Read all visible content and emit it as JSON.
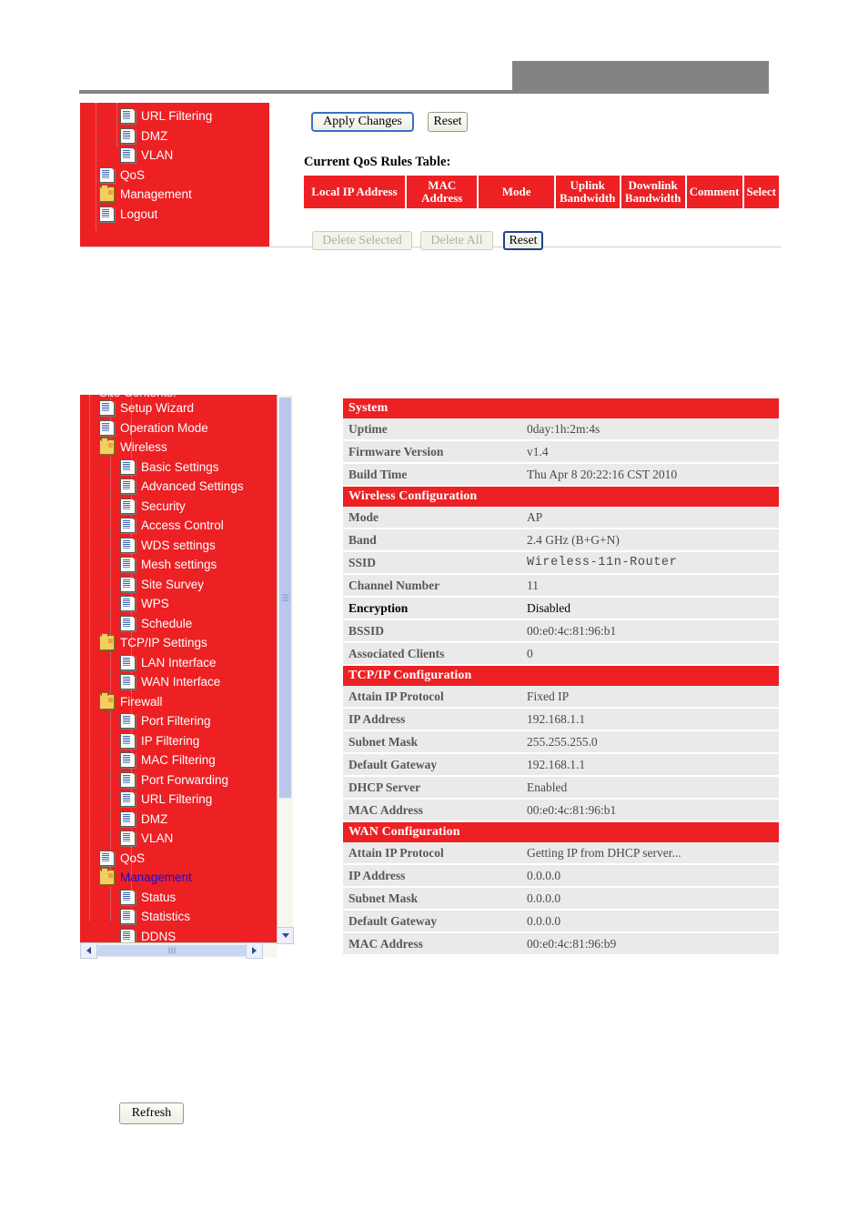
{
  "header": {
    "band_color": "#838383",
    "rule_color": "#838383"
  },
  "colors": {
    "sidebar_red": "#ED2024",
    "table_header_red": "#ED2024",
    "row_gray": "#EAEAEA",
    "selected_link_blue": "#1111DD"
  },
  "qos_panel": {
    "apply_button": "Apply Changes",
    "reset_button_top": "Reset",
    "table_caption": "Current QoS Rules Table:",
    "table_headers": [
      "Local IP Address",
      "MAC Address",
      "Mode",
      "Uplink Bandwidth",
      "Downlink Bandwidth",
      "Comment",
      "Select"
    ],
    "table_rows": [],
    "delete_selected_button": "Delete Selected",
    "delete_all_button": "Delete All",
    "reset_button_bottom": "Reset",
    "sidebar_items": [
      {
        "label": "URL Filtering",
        "icon": "page-icon",
        "level": 2
      },
      {
        "label": "DMZ",
        "icon": "page-icon",
        "level": 2
      },
      {
        "label": "VLAN",
        "icon": "page-icon",
        "level": 2
      },
      {
        "label": "QoS",
        "icon": "page-icon",
        "level": 1
      },
      {
        "label": "Management",
        "icon": "folder-icon",
        "level": 1
      },
      {
        "label": "Logout",
        "icon": "page-icon",
        "level": 1
      }
    ]
  },
  "status_panel": {
    "tree_title": "Site Contents:",
    "sidebar_items": [
      {
        "label": "Setup Wizard",
        "icon": "page-icon",
        "level": 1,
        "selected": false
      },
      {
        "label": "Operation Mode",
        "icon": "page-icon",
        "level": 1,
        "selected": false
      },
      {
        "label": "Wireless",
        "icon": "folder-icon",
        "level": 1,
        "selected": false
      },
      {
        "label": "Basic Settings",
        "icon": "page-icon",
        "level": 2,
        "selected": false
      },
      {
        "label": "Advanced Settings",
        "icon": "page-icon",
        "level": 2,
        "selected": false
      },
      {
        "label": "Security",
        "icon": "page-icon",
        "level": 2,
        "selected": false
      },
      {
        "label": "Access Control",
        "icon": "page-icon",
        "level": 2,
        "selected": false
      },
      {
        "label": "WDS settings",
        "icon": "page-icon",
        "level": 2,
        "selected": false
      },
      {
        "label": "Mesh settings",
        "icon": "page-icon",
        "level": 2,
        "selected": false
      },
      {
        "label": "Site Survey",
        "icon": "page-icon",
        "level": 2,
        "selected": false
      },
      {
        "label": "WPS",
        "icon": "page-icon",
        "level": 2,
        "selected": false
      },
      {
        "label": "Schedule",
        "icon": "page-icon",
        "level": 2,
        "selected": false
      },
      {
        "label": "TCP/IP Settings",
        "icon": "folder-icon",
        "level": 1,
        "selected": false
      },
      {
        "label": "LAN Interface",
        "icon": "page-icon",
        "level": 2,
        "selected": false
      },
      {
        "label": "WAN Interface",
        "icon": "page-icon",
        "level": 2,
        "selected": false
      },
      {
        "label": "Firewall",
        "icon": "folder-icon",
        "level": 1,
        "selected": false
      },
      {
        "label": "Port Filtering",
        "icon": "page-icon",
        "level": 2,
        "selected": false
      },
      {
        "label": "IP Filtering",
        "icon": "page-icon",
        "level": 2,
        "selected": false
      },
      {
        "label": "MAC Filtering",
        "icon": "page-icon",
        "level": 2,
        "selected": false
      },
      {
        "label": "Port Forwarding",
        "icon": "page-icon",
        "level": 2,
        "selected": false
      },
      {
        "label": "URL Filtering",
        "icon": "page-icon",
        "level": 2,
        "selected": false
      },
      {
        "label": "DMZ",
        "icon": "page-icon",
        "level": 2,
        "selected": false
      },
      {
        "label": "VLAN",
        "icon": "page-icon",
        "level": 2,
        "selected": false
      },
      {
        "label": "QoS",
        "icon": "page-icon",
        "level": 1,
        "selected": false
      },
      {
        "label": "Management",
        "icon": "folder-icon",
        "level": 1,
        "selected": true
      },
      {
        "label": "Status",
        "icon": "page-icon",
        "level": 2,
        "selected": false
      },
      {
        "label": "Statistics",
        "icon": "page-icon",
        "level": 2,
        "selected": false
      },
      {
        "label": "DDNS",
        "icon": "page-icon",
        "level": 2,
        "selected": false
      }
    ],
    "sections": [
      {
        "title": "System",
        "rows": [
          {
            "key": "Uptime",
            "value": "0day:1h:2m:4s",
            "emphasis": false,
            "mono": false
          },
          {
            "key": "Firmware Version",
            "value": "v1.4",
            "emphasis": false,
            "mono": false
          },
          {
            "key": "Build Time",
            "value": "Thu Apr 8 20:22:16 CST 2010",
            "emphasis": false,
            "mono": false
          }
        ]
      },
      {
        "title": "Wireless Configuration",
        "rows": [
          {
            "key": "Mode",
            "value": "AP",
            "emphasis": false,
            "mono": false
          },
          {
            "key": "Band",
            "value": "2.4 GHz (B+G+N)",
            "emphasis": false,
            "mono": false
          },
          {
            "key": "SSID",
            "value": "Wireless-11n-Router",
            "emphasis": false,
            "mono": true
          },
          {
            "key": "Channel Number",
            "value": "11",
            "emphasis": false,
            "mono": false
          },
          {
            "key": "Encryption",
            "value": "Disabled",
            "emphasis": true,
            "mono": false
          },
          {
            "key": "BSSID",
            "value": "00:e0:4c:81:96:b1",
            "emphasis": false,
            "mono": false
          },
          {
            "key": "Associated Clients",
            "value": "0",
            "emphasis": false,
            "mono": false
          }
        ]
      },
      {
        "title": "TCP/IP Configuration",
        "rows": [
          {
            "key": "Attain IP Protocol",
            "value": "Fixed IP",
            "emphasis": false,
            "mono": false
          },
          {
            "key": "IP Address",
            "value": "192.168.1.1",
            "emphasis": false,
            "mono": false
          },
          {
            "key": "Subnet Mask",
            "value": "255.255.255.0",
            "emphasis": false,
            "mono": false
          },
          {
            "key": "Default Gateway",
            "value": "192.168.1.1",
            "emphasis": false,
            "mono": false
          },
          {
            "key": "DHCP Server",
            "value": "Enabled",
            "emphasis": false,
            "mono": false
          },
          {
            "key": "MAC Address",
            "value": "00:e0:4c:81:96:b1",
            "emphasis": false,
            "mono": false
          }
        ]
      },
      {
        "title": "WAN Configuration",
        "rows": [
          {
            "key": "Attain IP Protocol",
            "value": "Getting IP from DHCP server...",
            "emphasis": false,
            "mono": false
          },
          {
            "key": "IP Address",
            "value": "0.0.0.0",
            "emphasis": false,
            "mono": false
          },
          {
            "key": "Subnet Mask",
            "value": "0.0.0.0",
            "emphasis": false,
            "mono": false
          },
          {
            "key": "Default Gateway",
            "value": "0.0.0.0",
            "emphasis": false,
            "mono": false
          },
          {
            "key": "MAC Address",
            "value": "00:e0:4c:81:96:b9",
            "emphasis": false,
            "mono": false
          }
        ]
      }
    ]
  },
  "footer": {
    "refresh_button": "Refresh"
  }
}
